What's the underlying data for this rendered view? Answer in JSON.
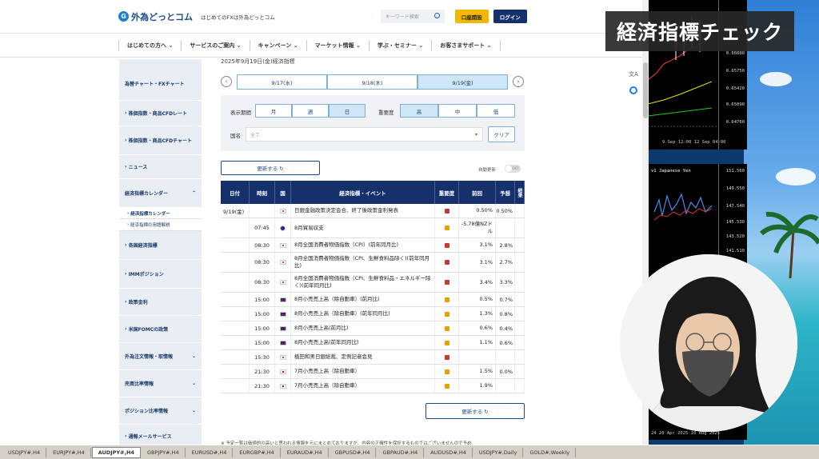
{
  "site": {
    "logo": "外為どっとコム",
    "tagline": "はじめてのFXは外為どっとコム",
    "search_placeholder": "キーワード検索",
    "open_account": "口座開設",
    "login": "ログイン"
  },
  "nav": [
    "はじめての方へ",
    "サービスのご案内",
    "キャンペーン",
    "マーケット情報",
    "学ぶ・セミナー",
    "お客さまサポート"
  ],
  "sidebar": {
    "items": [
      "為替チャート・FXチャート",
      "株価指数・商品CFDレート",
      "株価指数・商品CFDチャート",
      "ニュース",
      "経済指標カレンダー",
      "各国経済指標",
      "IMMポジション",
      "政策金利",
      "米国FOMCの政策",
      "外為注文情報・取情報",
      "売買比率情報",
      "ポジション比率情報",
      "通報メールサービス"
    ],
    "subitems": [
      "経済指標カレンダー",
      "経済指標の用語解説"
    ]
  },
  "main": {
    "breadcrumb": "2025年9月19日(金)経済指標",
    "dates": [
      "9/17(水)",
      "9/18(木)",
      "9/19(金)"
    ],
    "period_label": "表示期間",
    "periods": [
      "月",
      "週",
      "日"
    ],
    "importance_label": "重要度",
    "importance": [
      "高",
      "中",
      "低"
    ],
    "country_label": "国名",
    "country_value": "全て",
    "clear": "クリア",
    "refresh": "更新する ↻",
    "auto_label": "自動更新",
    "auto_state": "OFF",
    "disclaimer": "※ 予定一覧は価値的の高いと思われる情報を元にまとめておりますが、内容の正確性を保証するものではございませんので予め"
  },
  "table": {
    "headers": [
      "日付",
      "時刻",
      "国",
      "経済指標・イベント",
      "重要度",
      "前回",
      "予想",
      "結果"
    ],
    "date": "9/19(金)",
    "rows": [
      {
        "time": "",
        "flag": "jp",
        "event": "日銀金融政策決定会合、終了後政策金利発表",
        "imp": "high",
        "prev": "0.50%",
        "fc": "0.50%"
      },
      {
        "time": "07:45",
        "flag": "nz",
        "event": "8月貿易収支",
        "imp": "mid",
        "prev": "-5.78億NZドル",
        "fc": ""
      },
      {
        "time": "08:30",
        "flag": "jp",
        "event": "8月全国消費者物価指数（CPI）(前年同月比)",
        "imp": "high",
        "prev": "3.1%",
        "fc": "2.8%"
      },
      {
        "time": "08:30",
        "flag": "jp",
        "event": "8月全国消費者物価指数（CPI、生鮮食料品除く)(前年同月比)",
        "imp": "high",
        "prev": "3.1%",
        "fc": "2.7%"
      },
      {
        "time": "08:30",
        "flag": "jp",
        "event": "8月全国消費者物価指数（CPI、生鮮食料品・エネルギー除く)(前年同月比)",
        "imp": "high",
        "prev": "3.4%",
        "fc": "3.3%"
      },
      {
        "time": "15:00",
        "flag": "uk",
        "event": "8月小売売上高（除自動車）(前月比)",
        "imp": "mid",
        "prev": "0.5%",
        "fc": "0.7%"
      },
      {
        "time": "15:00",
        "flag": "uk",
        "event": "8月小売売上高（除自動車）(前年同月比)",
        "imp": "mid",
        "prev": "1.3%",
        "fc": "0.8%"
      },
      {
        "time": "15:00",
        "flag": "uk",
        "event": "8月小売売上高(前月比)",
        "imp": "mid",
        "prev": "0.6%",
        "fc": "0.4%"
      },
      {
        "time": "15:00",
        "flag": "uk",
        "event": "8月小売売上高(前年同月比)",
        "imp": "mid",
        "prev": "1.1%",
        "fc": "0.6%"
      },
      {
        "time": "15:30",
        "flag": "jp",
        "event": "植田和男日銀総裁、定例記者会見",
        "imp": "high",
        "prev": "",
        "fc": ""
      },
      {
        "time": "21:30",
        "flag": "ca",
        "event": "7月小売売上高（除自動車）",
        "imp": "mid",
        "prev": "1.5%",
        "fc": "0.0%"
      },
      {
        "time": "21:30",
        "flag": "ca",
        "event": "7月小売売上高（除自動車）",
        "imp": "mid",
        "prev": "1.9%",
        "fc": ""
      }
    ]
  },
  "caption": "経済指標チェック",
  "mt": {
    "top_scale": [
      "0.66000",
      "0.65750",
      "0.65420",
      "0.65090",
      "0.64760"
    ],
    "top_times": "9 Sep 12:00    12 Sep 04:00",
    "mid_title": "v1 Japanese Yen",
    "mid_scale": [
      "151.560",
      "149.550",
      "147.540",
      "145.530",
      "143.520",
      "141.510"
    ],
    "mid_times": "24    20 Apr 2025    10 Aug 2025"
  },
  "taskbar": [
    "USDJPY#,H4",
    "EURJPY#,H4",
    "AUDJPY#,H4",
    "GBPJPY#,H4",
    "EURUSD#,H4",
    "EURGBP#,H4",
    "EURAUD#,H4",
    "GBPUSD#,H4",
    "GBPAUD#,H4",
    "AUDUSD#,H4",
    "USDJPY#,Daily",
    "GOLD#,Weekly"
  ],
  "colors": {
    "navy": "#15306a",
    "accent_blue": "#1a7fd4",
    "yellow": "#f5b800",
    "high": "#c8382d",
    "mid": "#e8a000"
  }
}
